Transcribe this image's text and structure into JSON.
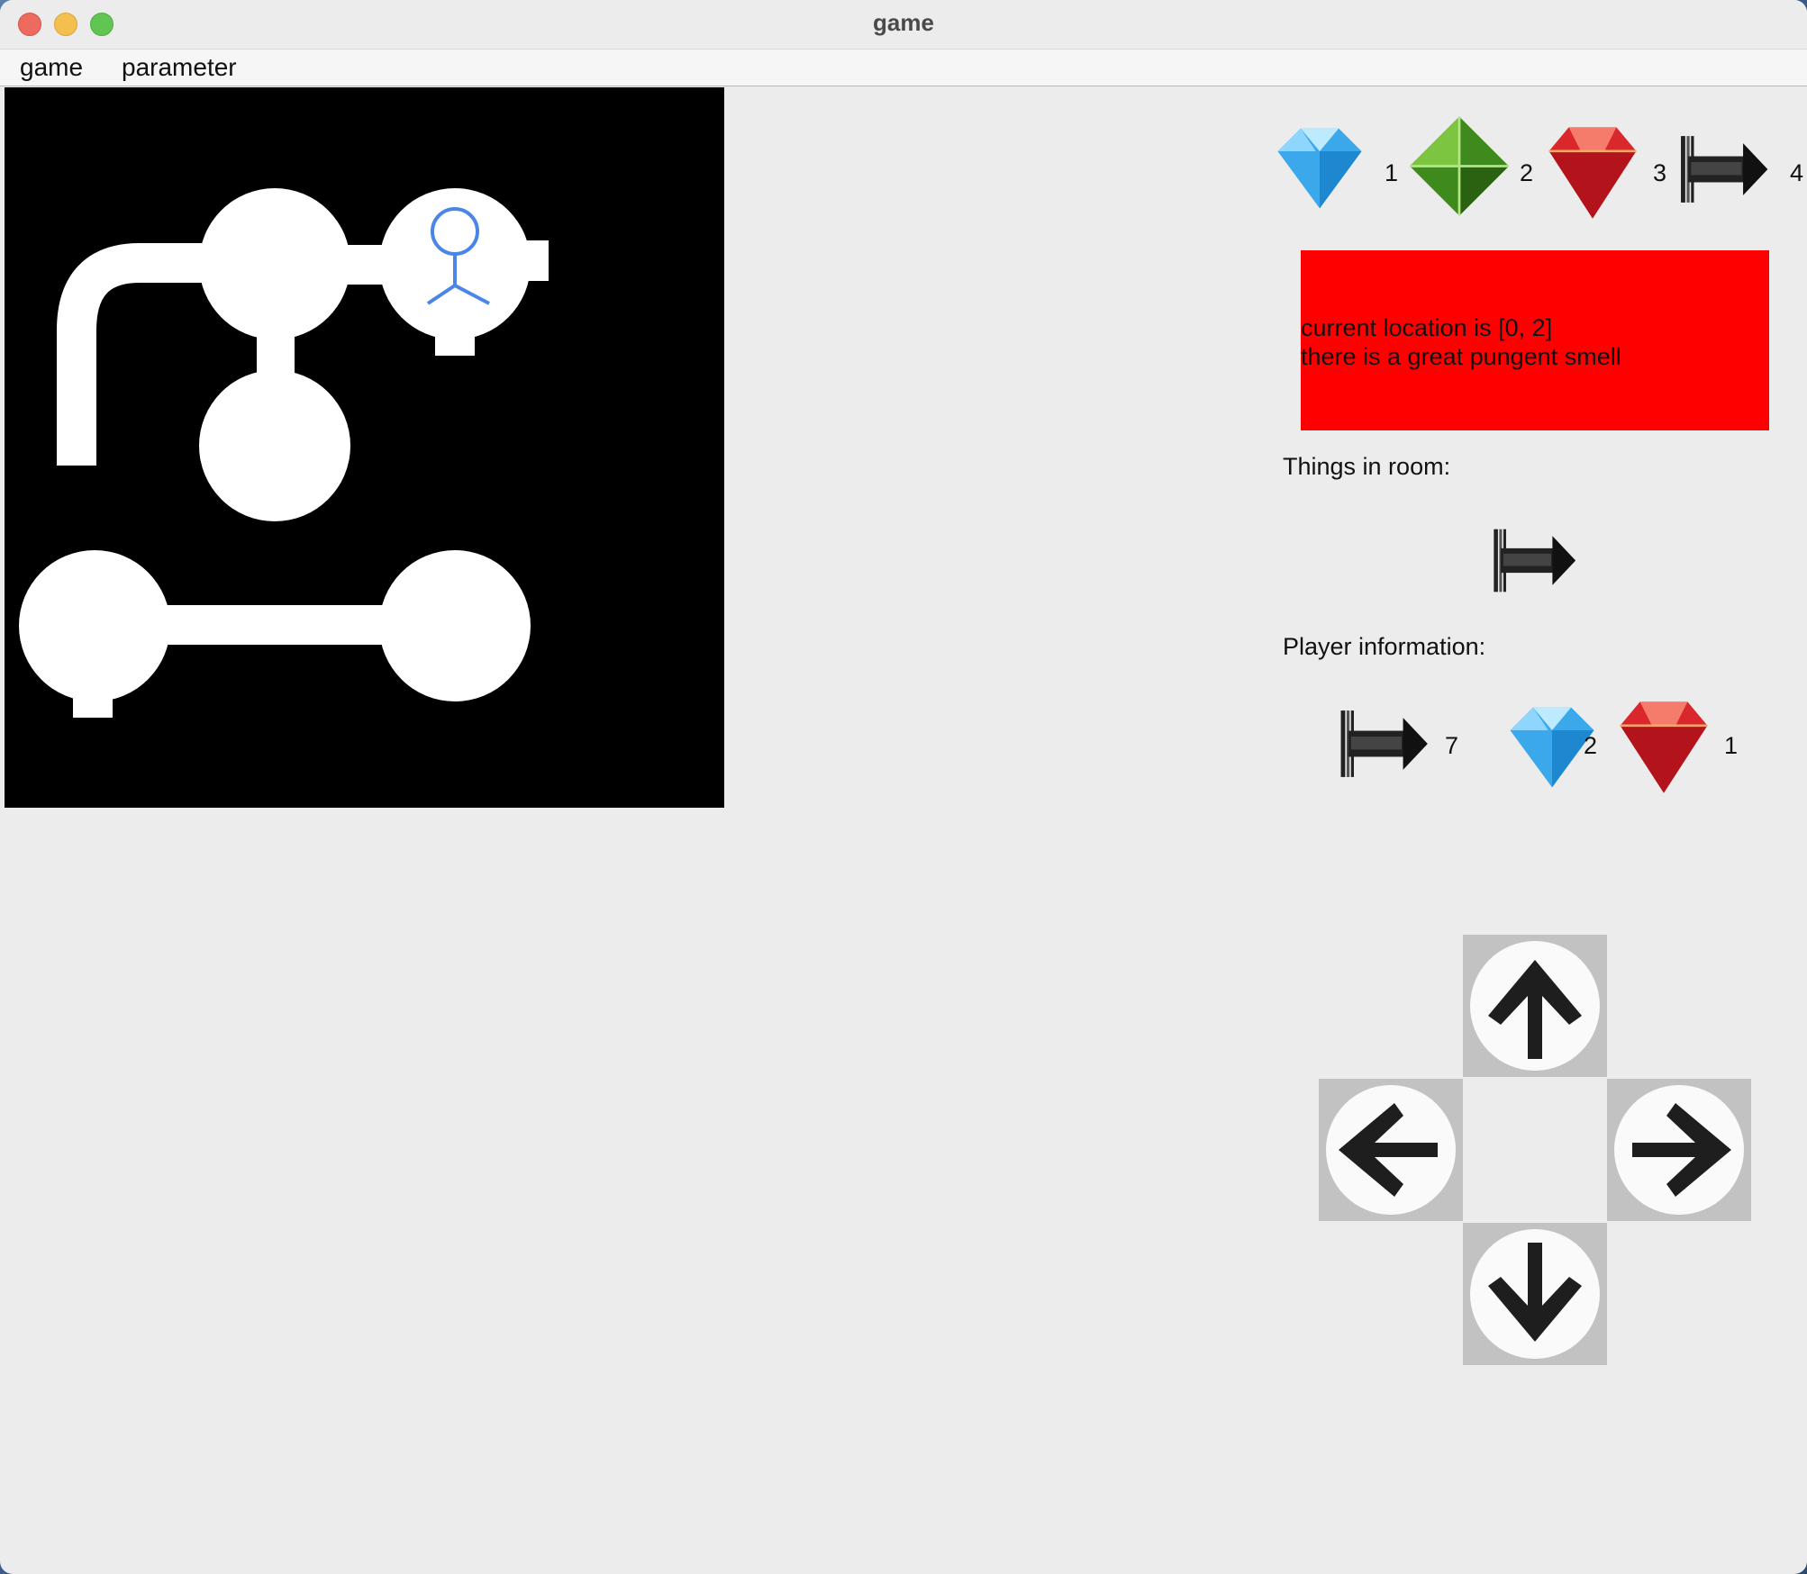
{
  "window": {
    "title": "game"
  },
  "menu": [
    "game",
    "parameter"
  ],
  "treasures_legend": [
    {
      "icon": "blue-diamond-icon",
      "label": "1"
    },
    {
      "icon": "green-gem-icon",
      "label": "2"
    },
    {
      "icon": "red-ruby-icon",
      "label": "3"
    },
    {
      "icon": "arrow-icon",
      "label": "4"
    }
  ],
  "status": {
    "line1": "current location is [0, 2]",
    "line2": "there is a great pungent smell",
    "background": "#ff0000"
  },
  "room": {
    "heading": "Things in room:",
    "items": [
      "arrow-icon"
    ]
  },
  "player": {
    "heading": "Player information:",
    "items": [
      {
        "icon": "arrow-icon",
        "count": "7"
      },
      {
        "icon": "blue-diamond-icon",
        "count": "2"
      },
      {
        "icon": "red-ruby-icon",
        "count": "1"
      }
    ]
  },
  "controls": [
    "up-arrow-icon",
    "left-arrow-icon",
    "right-arrow-icon",
    "down-arrow-icon"
  ],
  "colors": {
    "map_bg": "#000000",
    "room": "#ffffff",
    "player": "#4a86e8"
  }
}
